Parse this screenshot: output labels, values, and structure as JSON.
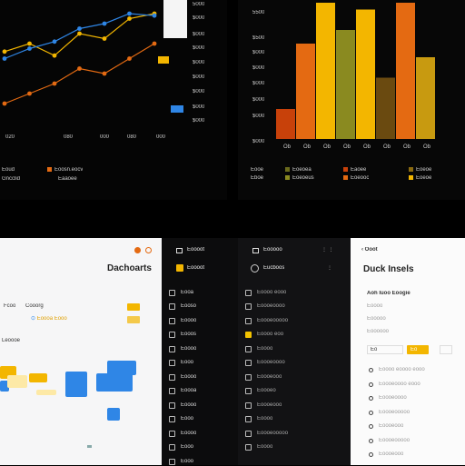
{
  "colors": {
    "orange": "#e46a12",
    "yellow": "#f3b600",
    "blue": "#2f86e6",
    "dark_orange": "#c8410a",
    "olive": "#4d4712"
  },
  "line_panel": {
    "values_right": [
      "5000",
      "$000",
      "$000",
      "$000",
      "$000",
      "$000",
      "$000",
      "$000",
      "$000"
    ],
    "x_ticks": [
      "020",
      "080",
      "000",
      "080",
      "000"
    ],
    "legend": [
      "Eoud",
      "Gncclid"
    ],
    "legend_tags": [
      "Eoosn.eocv",
      "Eaaoee"
    ]
  },
  "chart_data": [
    {
      "type": "line",
      "title": "",
      "xlabel": "",
      "ylabel": "",
      "x_ticks": [
        "020",
        "080",
        "000",
        "080",
        "000"
      ],
      "y_ticks": [
        "5000",
        "$000",
        "$000",
        "$000",
        "$000",
        "$000",
        "$000",
        "$000",
        "$000"
      ],
      "series": [
        {
          "color": "#f3b600",
          "values": [
            62,
            70,
            58,
            80,
            75,
            95,
            100
          ]
        },
        {
          "color": "#e46a12",
          "values": [
            10,
            20,
            30,
            45,
            40,
            55,
            70
          ]
        },
        {
          "color": "#2f86e6",
          "values": [
            55,
            65,
            72,
            85,
            90,
            100,
            98
          ]
        }
      ]
    },
    {
      "type": "bar",
      "title": "",
      "y_ticks": [
        "5500",
        "$500",
        "$000",
        "$000",
        "$000",
        "$000",
        "$000",
        "$000"
      ],
      "categories": [
        "Ob",
        "Ob",
        "Ob",
        "Ob",
        "Ob",
        "Ob",
        "Ob",
        "Ob"
      ],
      "values": [
        22,
        70,
        100,
        80,
        95,
        45,
        100,
        60
      ],
      "legend": [
        "Eooe",
        "Eboe",
        "Eoeoea",
        "Eoeoeus",
        "Eaoee",
        "Eoeooc",
        "Eoeoe",
        "Eoeoe"
      ]
    }
  ],
  "light_panel": {
    "title": "Dachoarts",
    "labels": [
      "Fcoo",
      "Cooorg"
    ],
    "tag": "Eoooa Eooo",
    "section": "Leoooe"
  },
  "nav1": {
    "header": "Eoooot",
    "items": [
      "Eooa",
      "Eooso",
      "Eoooo",
      "Eooos",
      "Eoooo",
      "Eooo",
      "Eoooo",
      "Eoooa",
      "Eoooo",
      "Eooo",
      "Eoooo",
      "Eooo",
      "Eooo"
    ]
  },
  "nav2": {
    "header": "Eooooo",
    "title": "Eucboos",
    "items": [
      "Eoooo eooo",
      "Eoooeoooo",
      "Eoooeooooo",
      "Eoooo eoo",
      "Eoooo",
      "Eoooeoooo",
      "Eoooeooo",
      "Eoooeo",
      "Eoooeooo",
      "Eoooo",
      "Eoooeooooo",
      "Eoooo"
    ]
  },
  "right_panel": {
    "header": "Ooot",
    "title": "Duck Insels",
    "subtitle": "Aoh Iuoo Eoogie",
    "lines": [
      "Eoooo",
      "Eooooo",
      "Eoooooo"
    ],
    "tags": [
      "Eo",
      "Eo",
      "Eo"
    ],
    "rows": [
      "Eoooo eoooo eooo",
      "Eoooeoooo eooo",
      "Eoooeoooo",
      "Eoooeooooo",
      "Eoooeooo",
      "Eoooeooooo",
      "Eoooeooo"
    ]
  }
}
